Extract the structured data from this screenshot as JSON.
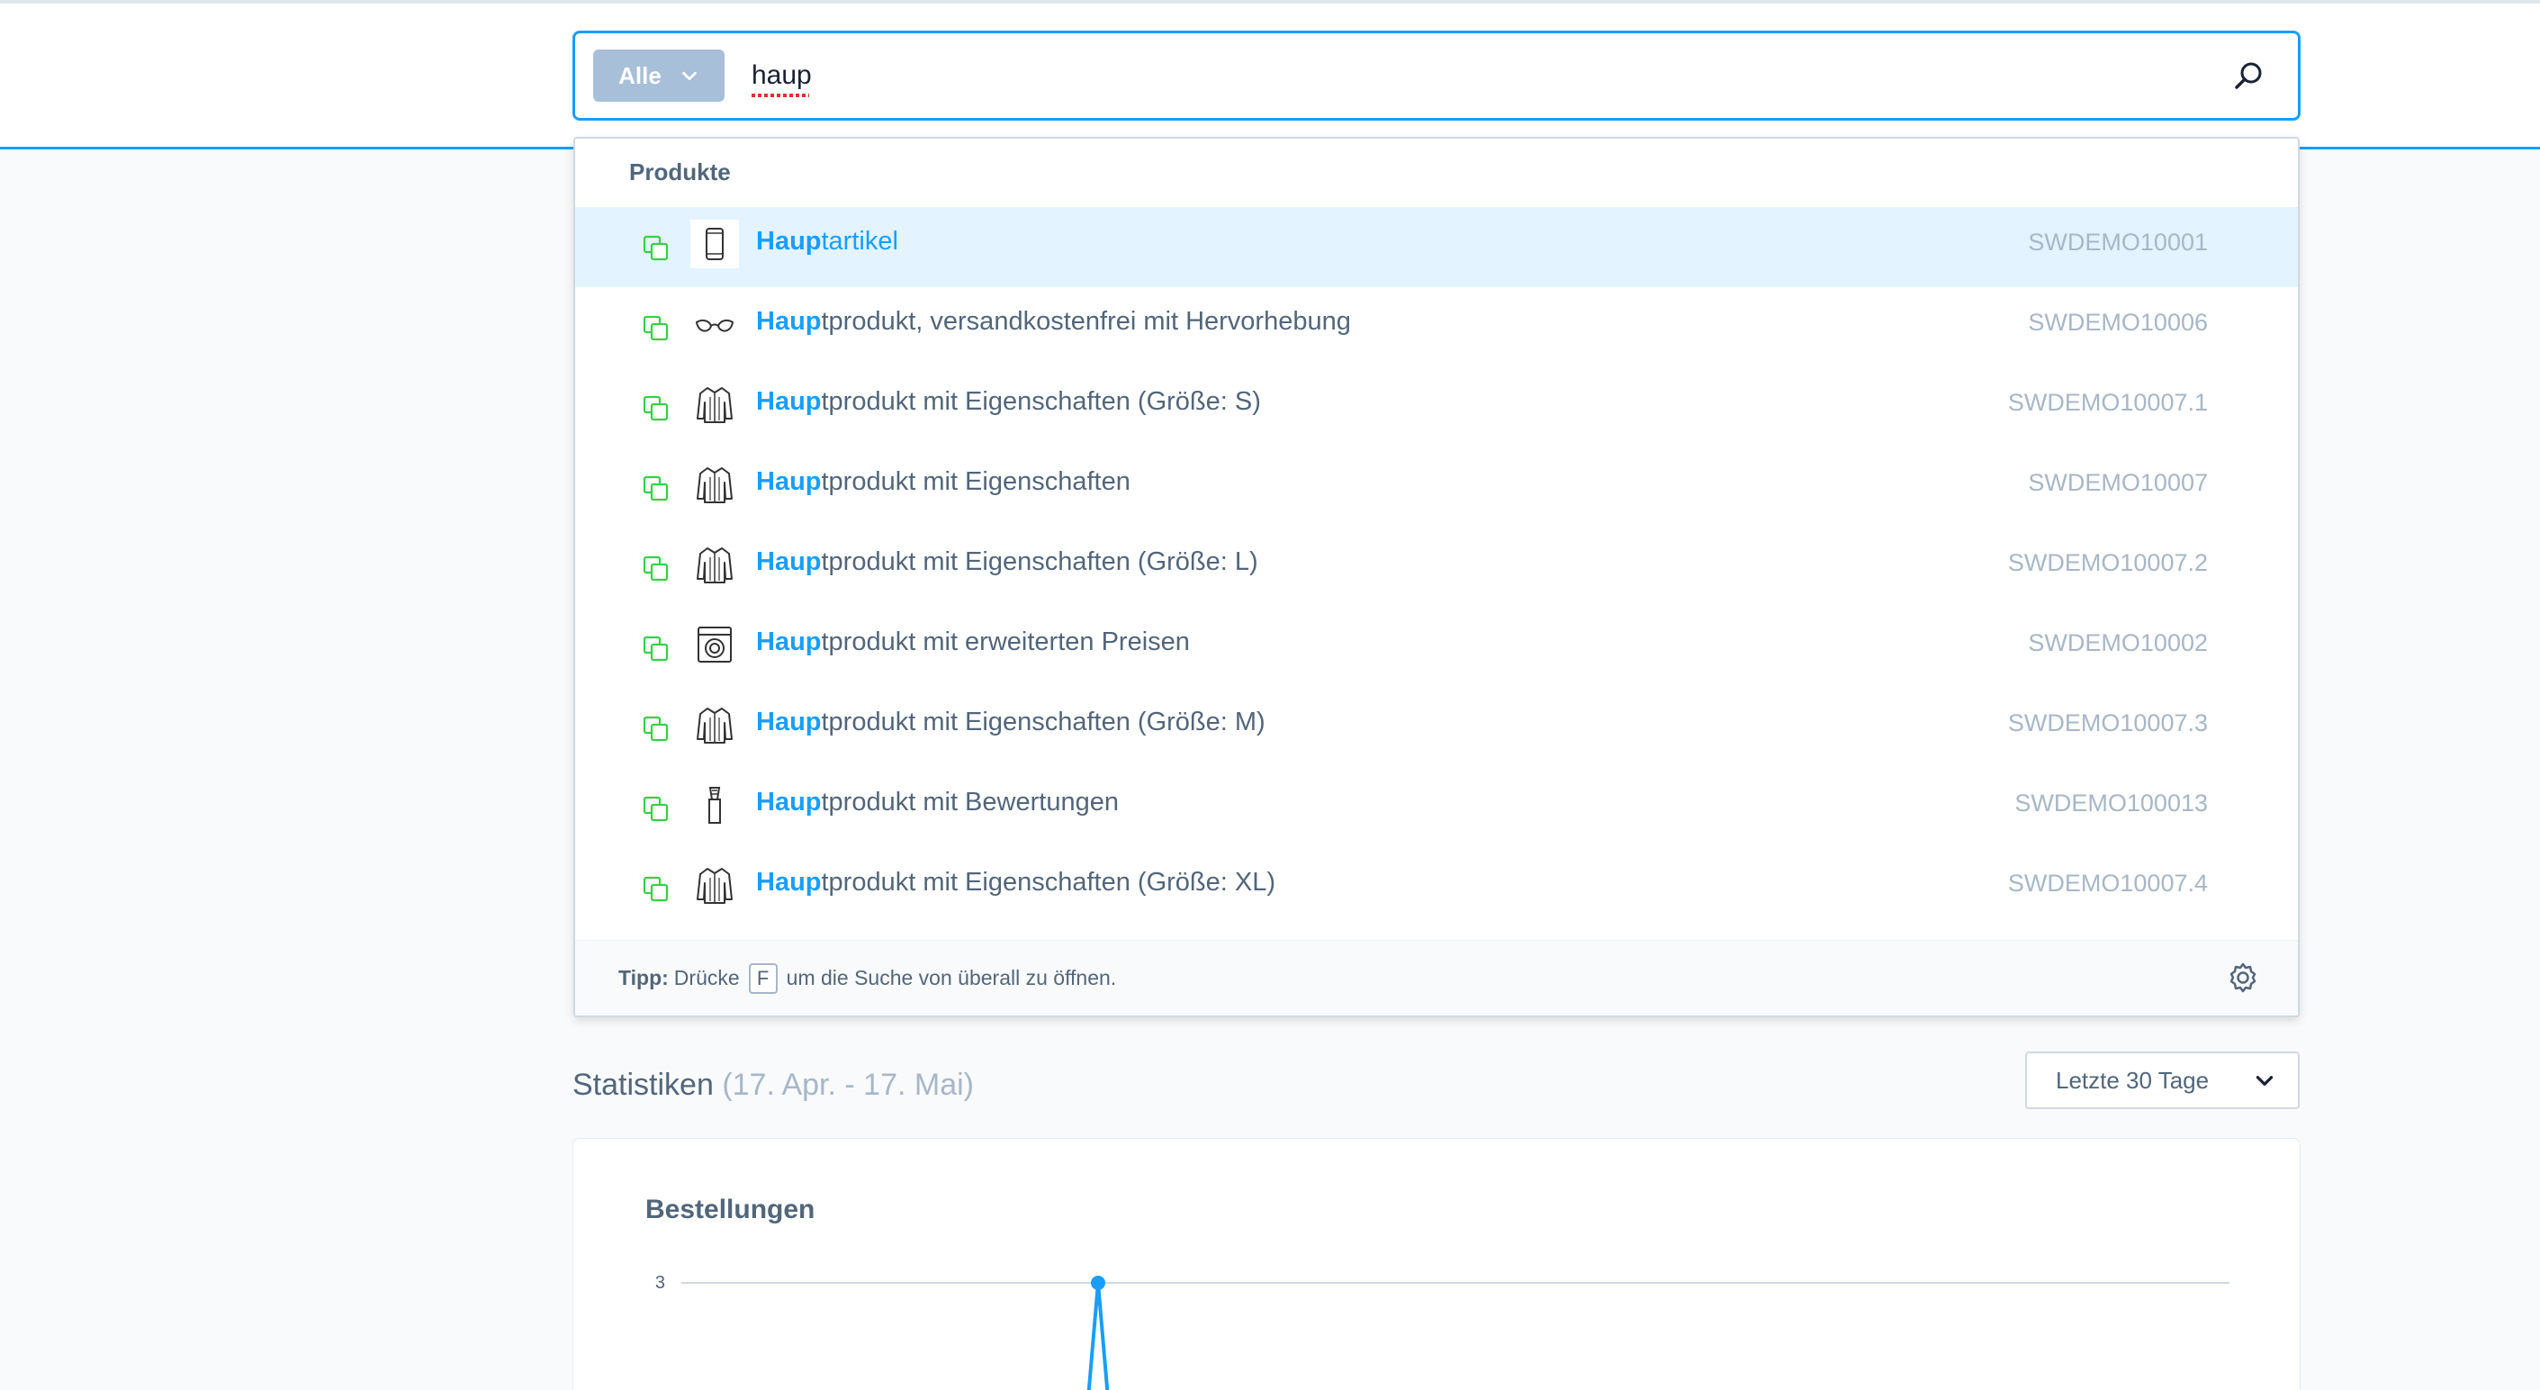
{
  "search": {
    "type_label": "Alle",
    "query": "haup"
  },
  "dropdown": {
    "section_title": "Produkte",
    "results": [
      {
        "highlight": "Haup",
        "rest": "tartikel",
        "sku": "SWDEMO10001",
        "thumb": "phone",
        "active": true
      },
      {
        "highlight": "Haup",
        "rest": "tprodukt, versandkostenfrei mit Hervorhebung",
        "sku": "SWDEMO10006",
        "thumb": "glasses",
        "active": false
      },
      {
        "highlight": "Haup",
        "rest": "tprodukt mit Eigenschaften (Größe: S)",
        "sku": "SWDEMO10007.1",
        "thumb": "jacket",
        "active": false
      },
      {
        "highlight": "Haup",
        "rest": "tprodukt mit Eigenschaften",
        "sku": "SWDEMO10007",
        "thumb": "jacket",
        "active": false
      },
      {
        "highlight": "Haup",
        "rest": "tprodukt mit Eigenschaften (Größe: L)",
        "sku": "SWDEMO10007.2",
        "thumb": "jacket",
        "active": false
      },
      {
        "highlight": "Haup",
        "rest": "tprodukt mit erweiterten Preisen",
        "sku": "SWDEMO10002",
        "thumb": "washer",
        "active": false
      },
      {
        "highlight": "Haup",
        "rest": "tprodukt mit Eigenschaften (Größe: M)",
        "sku": "SWDEMO10007.3",
        "thumb": "jacket",
        "active": false
      },
      {
        "highlight": "Haup",
        "rest": "tprodukt mit Bewertungen",
        "sku": "SWDEMO100013",
        "thumb": "bottle",
        "active": false
      },
      {
        "highlight": "Haup",
        "rest": "tprodukt mit Eigenschaften (Größe: XL)",
        "sku": "SWDEMO10007.4",
        "thumb": "jacket",
        "active": false
      }
    ],
    "tip": {
      "label": "Tipp:",
      "before": "Drücke",
      "key": "F",
      "after": "um die Suche von überall zu öffnen."
    }
  },
  "stats": {
    "title": "Statistiken",
    "range": "(17. Apr. - 17. Mai)",
    "select_value": "Letzte 30 Tage"
  },
  "chart": {
    "title": "Bestellungen"
  },
  "chart_data": {
    "type": "line",
    "title": "Bestellungen",
    "y_ticks": [
      3
    ],
    "series": [
      {
        "values": [
          3
        ]
      }
    ]
  },
  "colors": {
    "accent": "#189eff",
    "active_row": "#e3f3ff",
    "copy_icon": "#37d046",
    "muted": "#a7b7c7"
  },
  "icons": {
    "type_chevron": "chevron-down-icon",
    "search": "search-icon",
    "copy": "copy-icon",
    "settings": "gear-icon",
    "select_chevron": "chevron-down-icon"
  }
}
